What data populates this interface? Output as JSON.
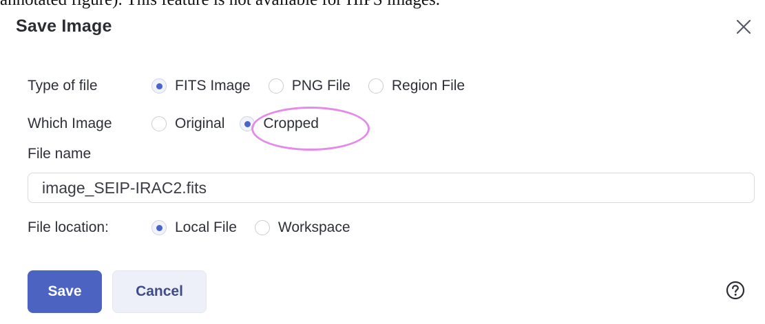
{
  "top_text": "annotated figure). This feature is not available for HiPS images.",
  "dialog": {
    "title": "Save Image",
    "close_icon": "close-icon",
    "type_of_file": {
      "label": "Type of file",
      "options": [
        "FITS Image",
        "PNG File",
        "Region File"
      ],
      "selected": "FITS Image"
    },
    "which_image": {
      "label": "Which Image",
      "options": [
        "Original",
        "Cropped"
      ],
      "selected": "Cropped"
    },
    "file_name": {
      "label": "File name",
      "value": "image_SEIP-IRAC2.fits"
    },
    "file_location": {
      "label": "File location:",
      "options": [
        "Local File",
        "Workspace"
      ],
      "selected": "Local File"
    },
    "save_label": "Save",
    "cancel_label": "Cancel",
    "help_icon": "help-circle-icon",
    "highlight_color": "#e48ae8",
    "accent_color": "#4d63c2"
  }
}
